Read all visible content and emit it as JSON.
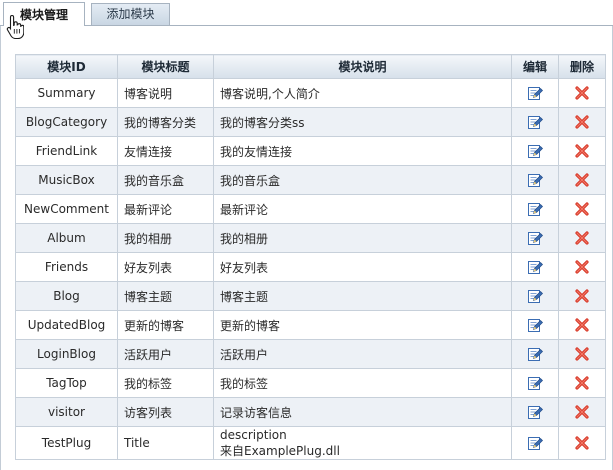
{
  "tabs": [
    {
      "label": "模块管理",
      "active": true
    },
    {
      "label": "添加模块",
      "active": false
    }
  ],
  "table": {
    "headers": [
      "模块ID",
      "模块标题",
      "模块说明",
      "编辑",
      "删除"
    ],
    "rows": [
      {
        "id": "Summary",
        "title": "博客说明",
        "desc": "博客说明,个人简介",
        "desc2": ""
      },
      {
        "id": "BlogCategory",
        "title": "我的博客分类",
        "desc": "我的博客分类ss",
        "desc2": ""
      },
      {
        "id": "FriendLink",
        "title": "友情连接",
        "desc": "我的友情连接",
        "desc2": ""
      },
      {
        "id": "MusicBox",
        "title": "我的音乐盒",
        "desc": "我的音乐盒",
        "desc2": ""
      },
      {
        "id": "NewComment",
        "title": "最新评论",
        "desc": "最新评论",
        "desc2": ""
      },
      {
        "id": "Album",
        "title": "我的相册",
        "desc": "我的相册",
        "desc2": ""
      },
      {
        "id": "Friends",
        "title": "好友列表",
        "desc": "好友列表",
        "desc2": ""
      },
      {
        "id": "Blog",
        "title": "博客主题",
        "desc": "博客主题",
        "desc2": ""
      },
      {
        "id": "UpdatedBlog",
        "title": "更新的博客",
        "desc": "更新的博客",
        "desc2": ""
      },
      {
        "id": "LoginBlog",
        "title": "活跃用户",
        "desc": "活跃用户",
        "desc2": ""
      },
      {
        "id": "TagTop",
        "title": "我的标签",
        "desc": "我的标签",
        "desc2": ""
      },
      {
        "id": "visitor",
        "title": "访客列表",
        "desc": "记录访客信息",
        "desc2": ""
      },
      {
        "id": "TestPlug",
        "title": "Title",
        "desc": "description",
        "desc2": "来自ExamplePlug.dll"
      }
    ]
  },
  "icons": {
    "edit": "edit-pencil-icon",
    "delete": "delete-x-icon",
    "cursor": "hand-pointer-icon"
  },
  "colors": {
    "edit_blue": "#3b6db3",
    "delete_red": "#d83a2a",
    "header_bg": "#d6e0ea",
    "alt_row": "#edf1f6",
    "grid_line": "#c7d0da"
  }
}
